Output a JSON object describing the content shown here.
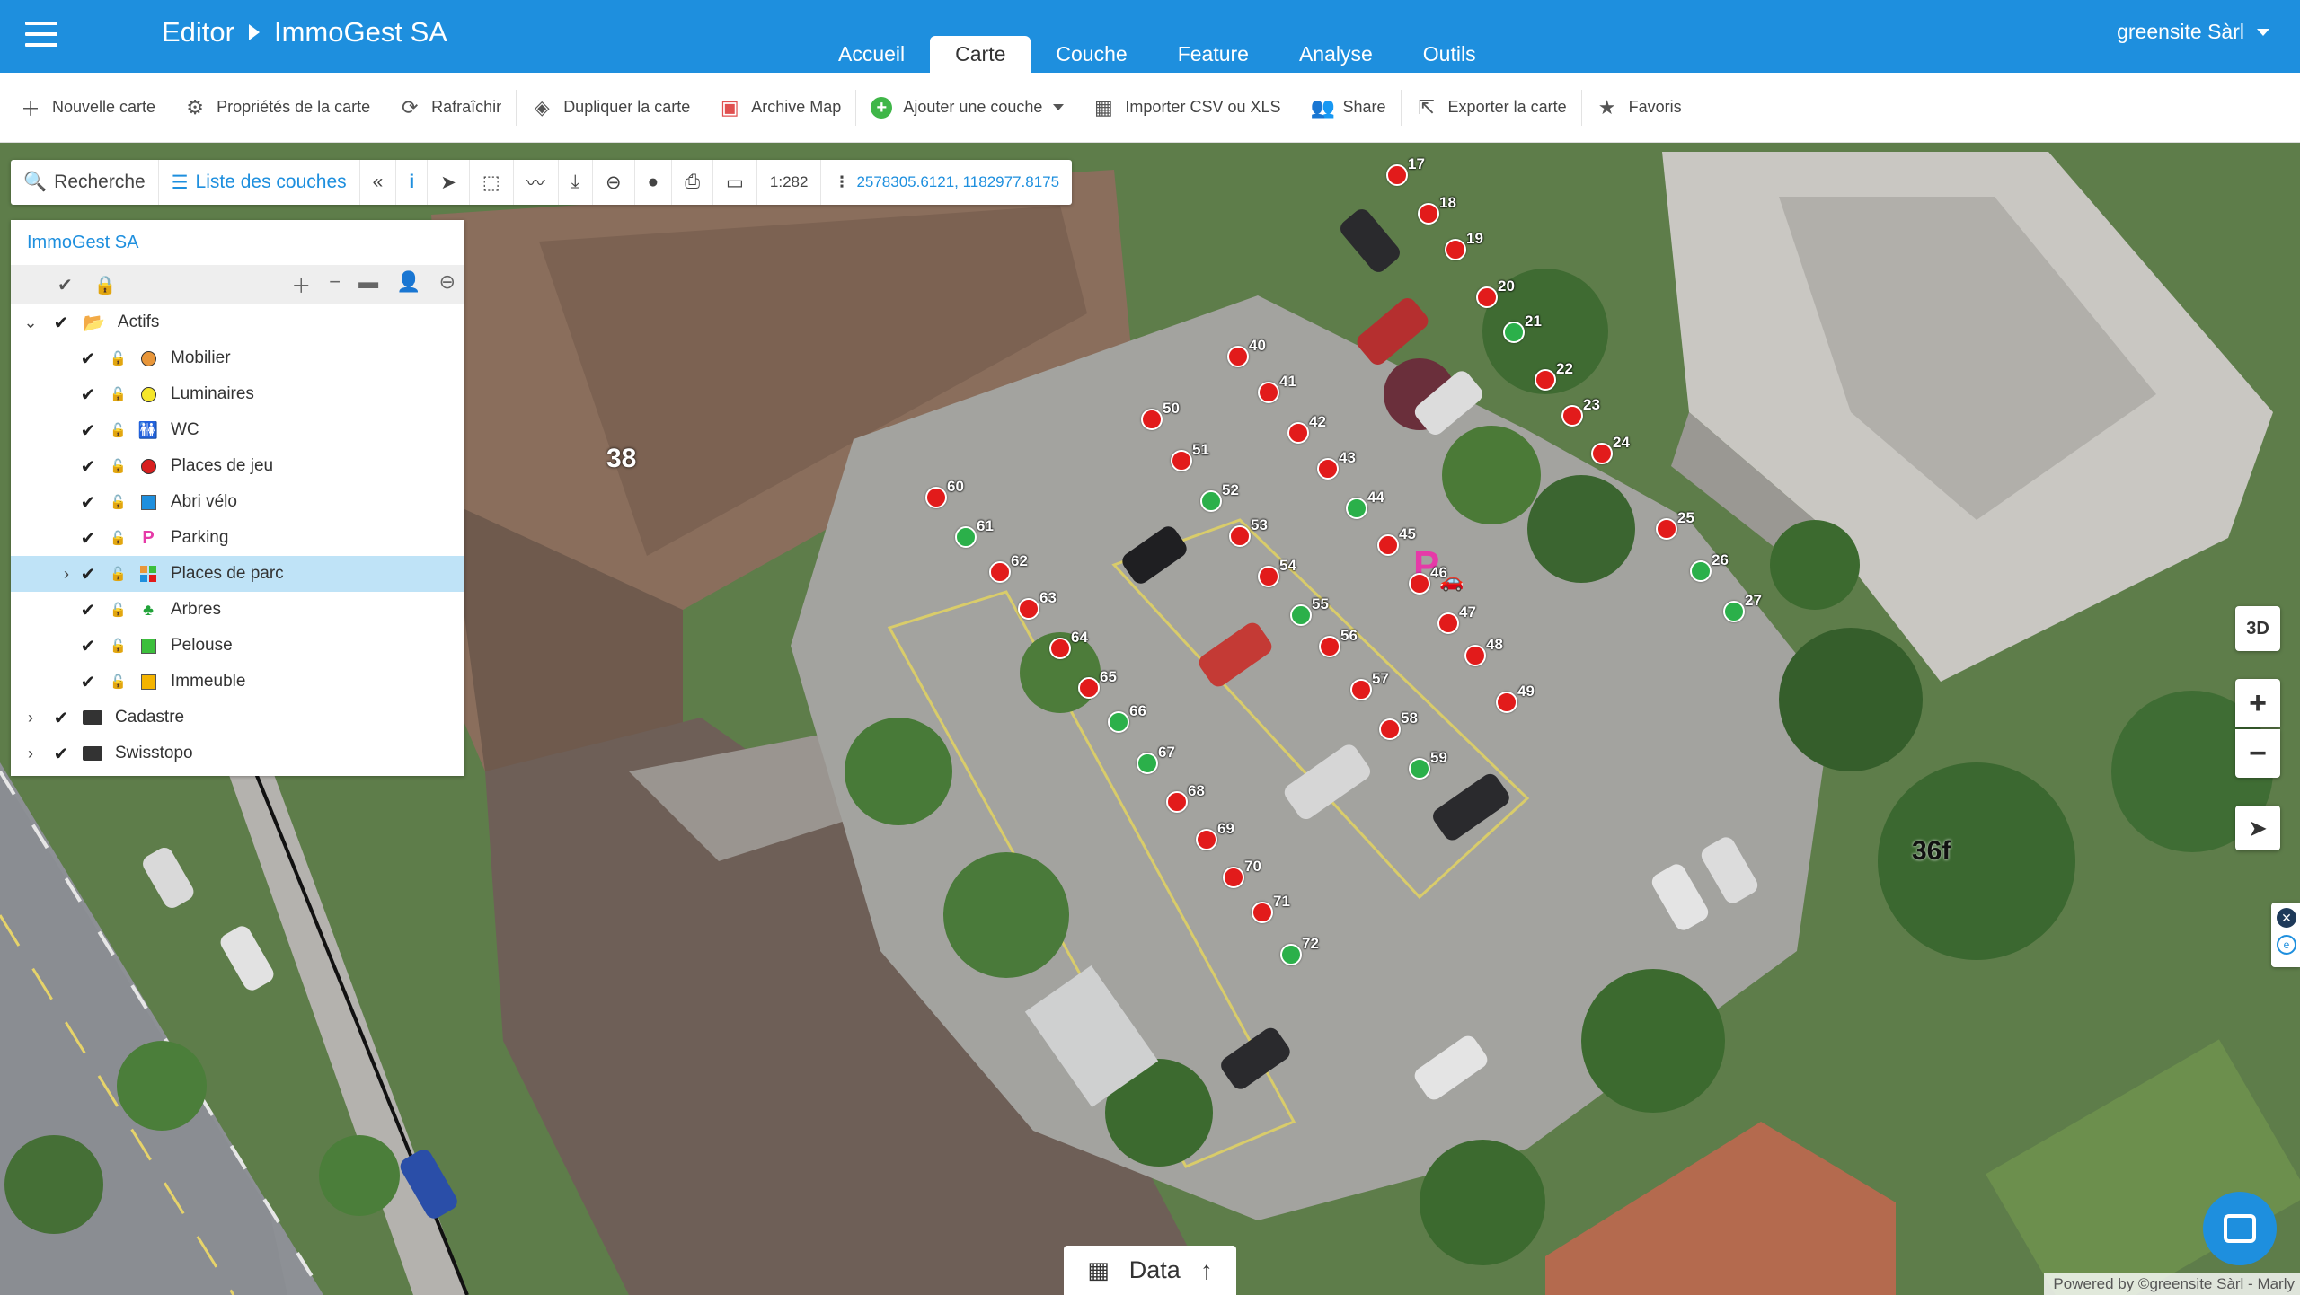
{
  "header": {
    "crumb_root": "Editor",
    "crumb_current": "ImmoGest SA",
    "tabs": [
      "Accueil",
      "Carte",
      "Couche",
      "Feature",
      "Analyse",
      "Outils"
    ],
    "active_tab": "Carte",
    "user": "greensite Sàrl"
  },
  "actions": [
    {
      "label": "Nouvelle carte",
      "icon": "plus-icon"
    },
    {
      "label": "Propriétés de la carte",
      "icon": "gear-icon"
    },
    {
      "label": "Rafraîchir",
      "icon": "refresh-icon"
    },
    {
      "label": "Dupliquer la carte",
      "icon": "layers-icon"
    },
    {
      "label": "Archive Map",
      "icon": "archive-icon"
    },
    {
      "label": "Ajouter une couche",
      "icon": "add-circle-icon"
    },
    {
      "label": "Importer CSV ou XLS",
      "icon": "table-icon"
    },
    {
      "label": "Share",
      "icon": "users-icon"
    },
    {
      "label": "Exporter la carte",
      "icon": "export-icon"
    },
    {
      "label": "Favoris",
      "icon": "star-icon"
    }
  ],
  "maptools": {
    "search": "Recherche",
    "layer_list": "Liste des couches",
    "scale": "1:282",
    "coords": "2578305.6121, 1182977.8175"
  },
  "layer_panel": {
    "title": "ImmoGest SA",
    "groups": [
      {
        "name": "Actifs",
        "expanded": true,
        "layers": [
          {
            "label": "Mobilier",
            "symbol": "circle",
            "color": "#e8963a"
          },
          {
            "label": "Luminaires",
            "symbol": "circle",
            "color": "#f5e62a"
          },
          {
            "label": "WC",
            "symbol": "wc",
            "color": "#1e8fde"
          },
          {
            "label": "Places de jeu",
            "symbol": "circle",
            "color": "#d71f1f"
          },
          {
            "label": "Abri vélo",
            "symbol": "square",
            "color": "#1e8fde"
          },
          {
            "label": "Parking",
            "symbol": "parking",
            "color": "#e63aa8"
          },
          {
            "label": "Places de parc",
            "symbol": "multi",
            "color": "#e8963a",
            "selected": true
          },
          {
            "label": "Arbres",
            "symbol": "tree",
            "color": "#22a33a"
          },
          {
            "label": "Pelouse",
            "symbol": "square",
            "color": "#3cbf3c"
          },
          {
            "label": "Immeuble",
            "symbol": "square",
            "color": "#f5b400"
          }
        ]
      },
      {
        "name": "Cadastre",
        "expanded": false
      },
      {
        "name": "Swisstopo",
        "expanded": false
      }
    ]
  },
  "map": {
    "building_labels": [
      "38",
      "36f"
    ],
    "parking_spots": [
      {
        "id": "17",
        "status": "red"
      },
      {
        "id": "18",
        "status": "red"
      },
      {
        "id": "19",
        "status": "red"
      },
      {
        "id": "20",
        "status": "red"
      },
      {
        "id": "21",
        "status": "green"
      },
      {
        "id": "22",
        "status": "red"
      },
      {
        "id": "23",
        "status": "red"
      },
      {
        "id": "24",
        "status": "red"
      },
      {
        "id": "25",
        "status": "red"
      },
      {
        "id": "26",
        "status": "green"
      },
      {
        "id": "27",
        "status": "green"
      },
      {
        "id": "40",
        "status": "red"
      },
      {
        "id": "41",
        "status": "red"
      },
      {
        "id": "42",
        "status": "red"
      },
      {
        "id": "43",
        "status": "red"
      },
      {
        "id": "44",
        "status": "green"
      },
      {
        "id": "45",
        "status": "red"
      },
      {
        "id": "46",
        "status": "red"
      },
      {
        "id": "47",
        "status": "red"
      },
      {
        "id": "48",
        "status": "red"
      },
      {
        "id": "49",
        "status": "red"
      },
      {
        "id": "50",
        "status": "red"
      },
      {
        "id": "51",
        "status": "red"
      },
      {
        "id": "52",
        "status": "green"
      },
      {
        "id": "53",
        "status": "red"
      },
      {
        "id": "54",
        "status": "red"
      },
      {
        "id": "55",
        "status": "green"
      },
      {
        "id": "56",
        "status": "red"
      },
      {
        "id": "57",
        "status": "red"
      },
      {
        "id": "58",
        "status": "red"
      },
      {
        "id": "59",
        "status": "green"
      },
      {
        "id": "60",
        "status": "red"
      },
      {
        "id": "61",
        "status": "green"
      },
      {
        "id": "62",
        "status": "red"
      },
      {
        "id": "63",
        "status": "red"
      },
      {
        "id": "64",
        "status": "red"
      },
      {
        "id": "65",
        "status": "red"
      },
      {
        "id": "66",
        "status": "green"
      },
      {
        "id": "67",
        "status": "green"
      },
      {
        "id": "68",
        "status": "red"
      },
      {
        "id": "69",
        "status": "red"
      },
      {
        "id": "70",
        "status": "red"
      },
      {
        "id": "71",
        "status": "red"
      },
      {
        "id": "72",
        "status": "green"
      }
    ],
    "colors": {
      "occupied": "#e21b1b",
      "free": "#2bb04a"
    }
  },
  "controls": {
    "view3d": "3D",
    "zoom_in": "+",
    "zoom_out": "−"
  },
  "bottom": {
    "data_label": "Data",
    "powered": "Powered by ©greensite Sàrl - Marly"
  }
}
